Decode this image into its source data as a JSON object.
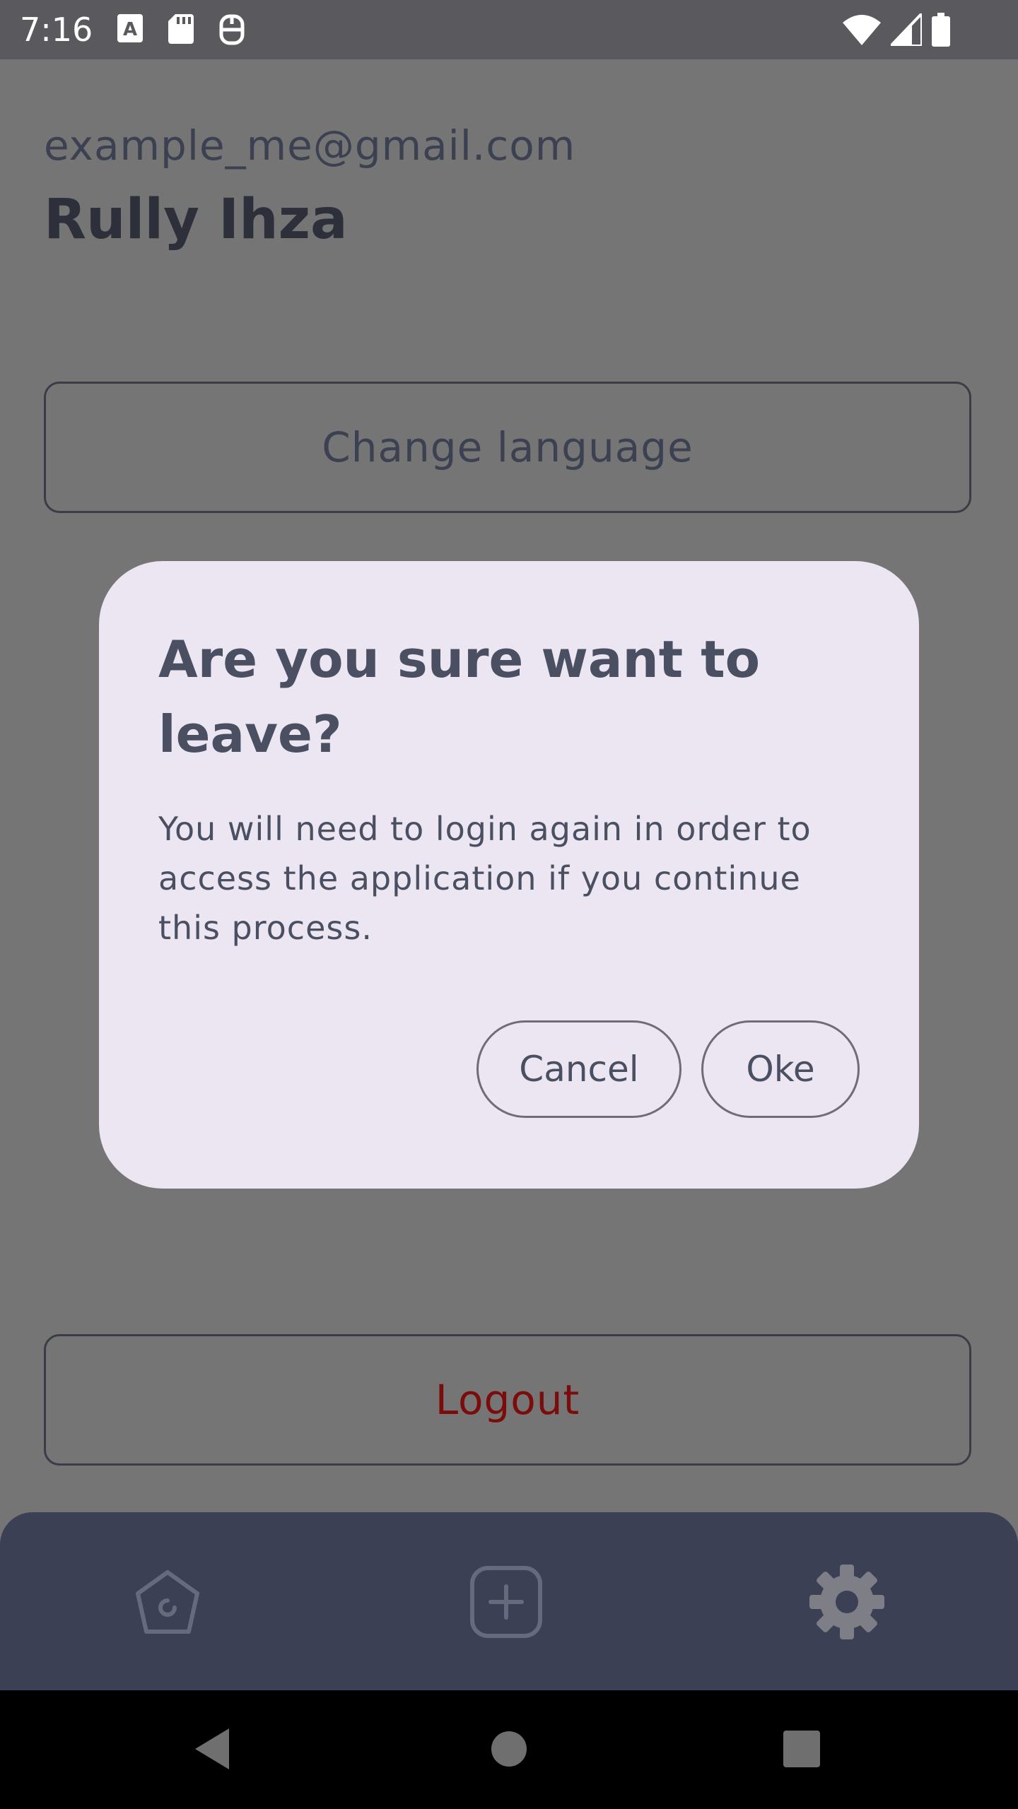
{
  "status_bar": {
    "time": "7:16",
    "left_icons": [
      "text-a-icon",
      "sd-card-icon",
      "accessibility-icon"
    ],
    "right_icons": [
      "wifi-icon",
      "cellular-signal-icon",
      "battery-icon"
    ]
  },
  "profile": {
    "email": "example_me@gmail.com",
    "name": "Rully Ihza"
  },
  "settings": {
    "change_language_label": "Change language",
    "logout_label": "Logout"
  },
  "dialog": {
    "title": "Are you sure want to leave?",
    "message": "You will need to login again in order to access the application if you continue this process.",
    "cancel_label": "Cancel",
    "ok_label": "Oke"
  },
  "bottom_nav": {
    "items": [
      {
        "icon": "home-icon"
      },
      {
        "icon": "add-square-icon"
      },
      {
        "icon": "gear-icon"
      }
    ]
  },
  "colors": {
    "scrim": "#757575",
    "dialog_bg": "#ece6f2",
    "bottom_nav_bg": "#3b4054",
    "logout_text": "#7a0c0c"
  }
}
